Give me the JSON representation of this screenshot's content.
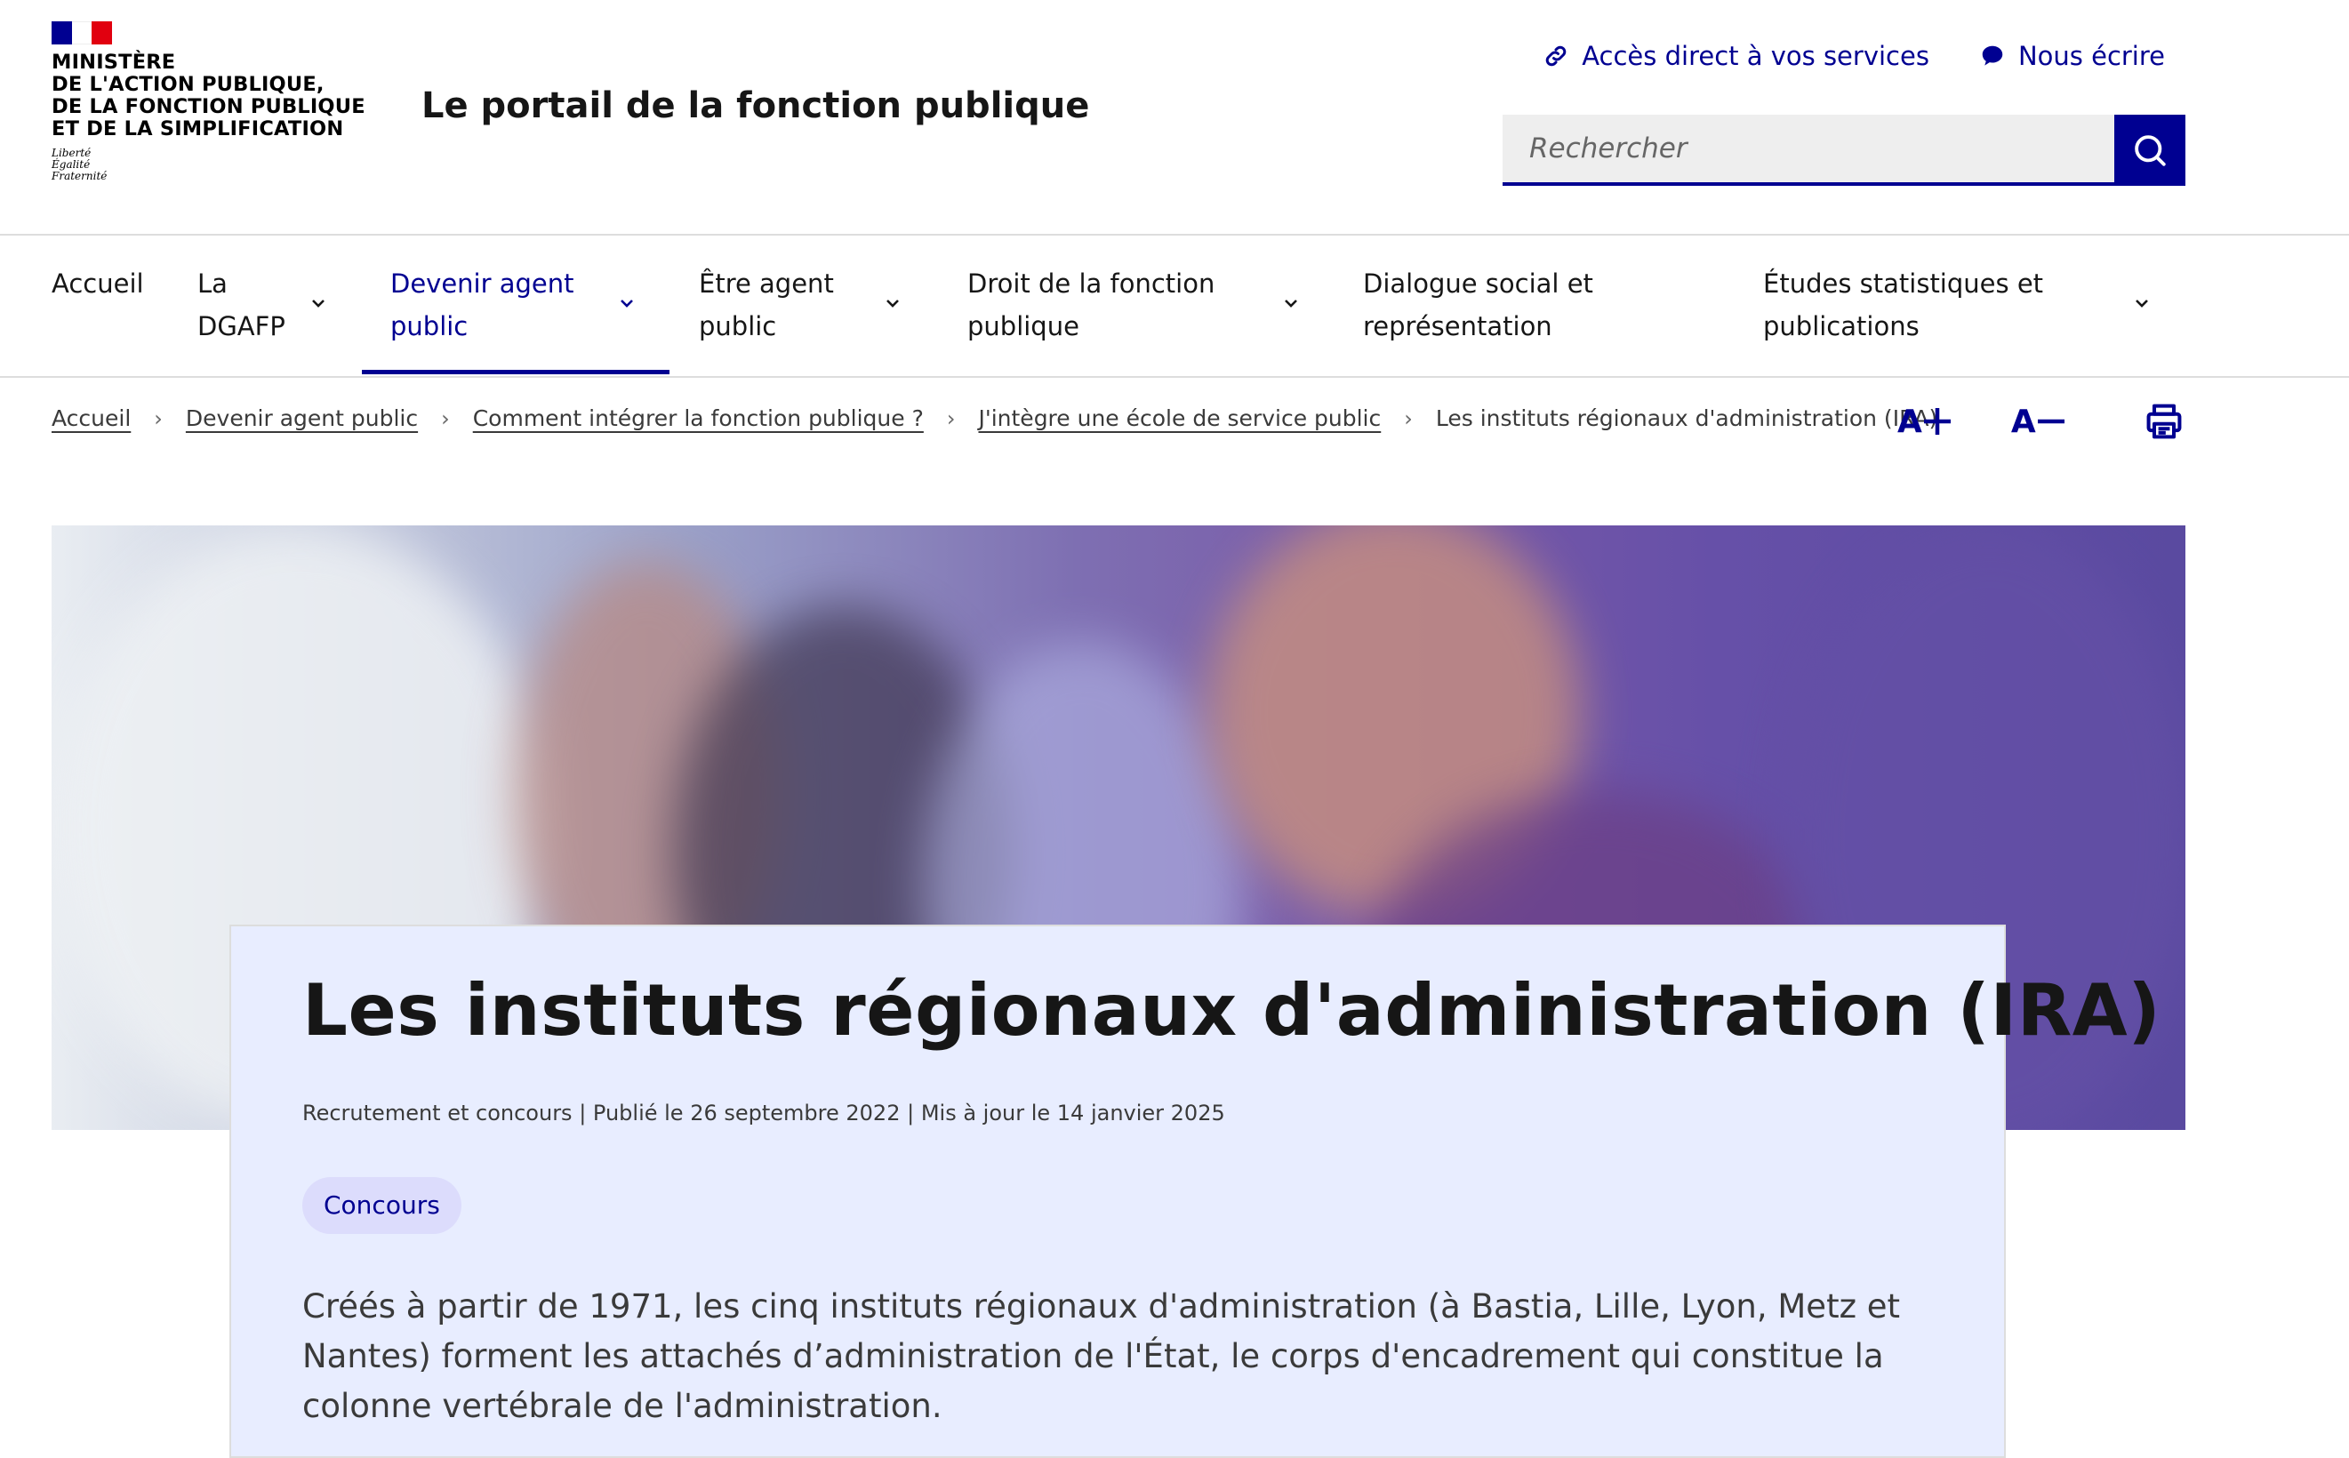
{
  "header": {
    "ministry_lines": [
      "MINISTÈRE",
      "DE L'ACTION PUBLIQUE,",
      "DE LA FONCTION PUBLIQUE",
      "ET DE LA SIMPLIFICATION"
    ],
    "devise": [
      "Liberté",
      "Égalité",
      "Fraternité"
    ],
    "site_title": "Le portail de la fonction publique",
    "quick_links": [
      {
        "label": "Accès direct à vos services",
        "icon": "link-icon"
      },
      {
        "label": "Nous écrire",
        "icon": "chat-bubble-icon"
      }
    ],
    "search": {
      "placeholder": "Rechercher",
      "value": ""
    }
  },
  "nav": {
    "items": [
      {
        "label": "Accueil",
        "active": false,
        "dropdown": false
      },
      {
        "label": "La DGAFP",
        "active": false,
        "dropdown": true
      },
      {
        "label": "Devenir agent public",
        "active": true,
        "dropdown": true
      },
      {
        "label": "Être agent public",
        "active": false,
        "dropdown": true
      },
      {
        "label": "Droit de la fonction publique",
        "active": false,
        "dropdown": true
      },
      {
        "label": "Dialogue social et représentation",
        "active": false,
        "dropdown": true
      },
      {
        "label": "Études statistiques et publications",
        "active": false,
        "dropdown": true
      }
    ]
  },
  "breadcrumb": {
    "links": [
      "Accueil",
      "Devenir agent public",
      "Comment intégrer la fonction publique ?",
      "J'intègre une école de service public"
    ],
    "current": "Les instituts régionaux d'administration (IRA)"
  },
  "tools": {
    "increase_font": "A",
    "decrease_font": "A"
  },
  "article": {
    "title": "Les instituts régionaux d'administration (IRA)",
    "meta": "Recrutement et concours | Publié le 26 septembre 2022 | Mis à jour le 14 janvier 2025",
    "tag": "Concours",
    "lead": "Créés à partir de 1971, les cinq instituts régionaux d'administration (à Bastia, Lille, Lyon, Metz et Nantes) forment les attachés d’administration de l'État, le corps d'encadrement qui constitue la colonne vertébrale de l'administration."
  },
  "colors": {
    "brand_blue": "#000091",
    "flag_red": "#e1000f",
    "card_bg": "#e8edff",
    "tag_bg": "#dcdcfc"
  }
}
